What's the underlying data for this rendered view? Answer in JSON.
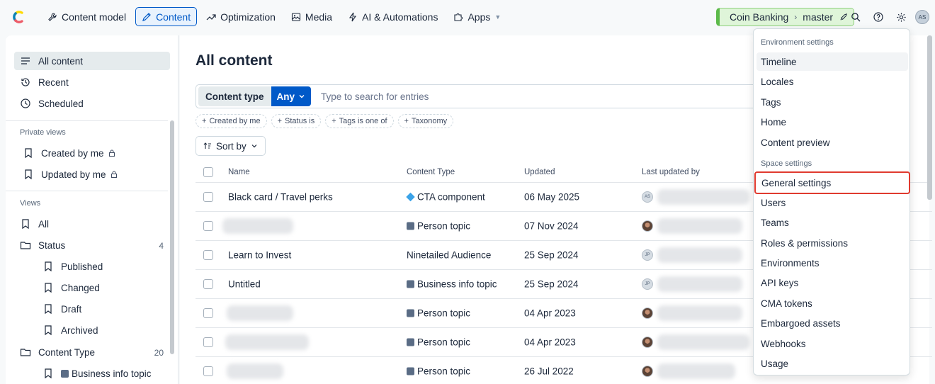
{
  "topbar": {
    "nav": [
      {
        "label": "Content model",
        "icon": "wrench-icon"
      },
      {
        "label": "Content",
        "icon": "pen-icon",
        "active": true
      },
      {
        "label": "Optimization",
        "icon": "trend-icon"
      },
      {
        "label": "Media",
        "icon": "image-icon"
      },
      {
        "label": "AI & Automations",
        "icon": "bolt-icon"
      },
      {
        "label": "Apps",
        "icon": "puzzle-icon"
      }
    ],
    "space": "Coin Banking",
    "environment": "master",
    "avatar_initials": "AS"
  },
  "sidebar": {
    "top": [
      "All content",
      "Recent",
      "Scheduled"
    ],
    "private_views_title": "Private views",
    "private_views": [
      "Created by me",
      "Updated by me"
    ],
    "views_title": "Views",
    "views": {
      "all": "All",
      "status": "Status",
      "status_count": "4",
      "status_children": [
        "Published",
        "Changed",
        "Draft",
        "Archived"
      ],
      "content_type": "Content Type",
      "content_type_count": "20",
      "content_type_children": [
        "Business info topic"
      ]
    }
  },
  "main": {
    "title": "All content",
    "search": {
      "content_type_label": "Content type",
      "any_label": "Any",
      "placeholder": "Type to search for entries"
    },
    "filters": [
      "Created by me",
      "Status is",
      "Tags is one of",
      "Taxonomy"
    ],
    "sort_label": "Sort by",
    "columns": [
      "Name",
      "Content Type",
      "Updated",
      "Last updated by"
    ],
    "rows": [
      {
        "name": "Black card / Travel perks",
        "type": "CTA component",
        "updated": "06 May 2025",
        "avatar": "AS"
      },
      {
        "name": "",
        "type": "Person topic",
        "updated": "07 Nov 2024",
        "avatar": ""
      },
      {
        "name": "Learn to Invest",
        "type": "Ninetailed Audience",
        "updated": "25 Sep 2024",
        "avatar": "JP"
      },
      {
        "name": "Untitled",
        "type": "Business info topic",
        "updated": "25 Sep 2024",
        "avatar": "JP"
      },
      {
        "name": "",
        "type": "Person topic",
        "updated": "04 Apr 2023",
        "avatar": ""
      },
      {
        "name": "",
        "type": "Person topic",
        "updated": "04 Apr 2023",
        "avatar": ""
      },
      {
        "name": "",
        "type": "Person topic",
        "updated": "26 Jul 2022",
        "avatar": ""
      }
    ]
  },
  "menu": {
    "environment_title": "Environment settings",
    "environment_items": [
      "Timeline",
      "Locales",
      "Tags",
      "Home",
      "Content preview"
    ],
    "space_title": "Space settings",
    "space_items": [
      "General settings",
      "Users",
      "Teams",
      "Roles & permissions",
      "Environments",
      "API keys",
      "CMA tokens",
      "Embargoed assets",
      "Webhooks",
      "Usage"
    ]
  },
  "colors": {
    "accent": "#0059c8",
    "highlight": "#e03a2f",
    "env_green": "#dff5d9"
  }
}
